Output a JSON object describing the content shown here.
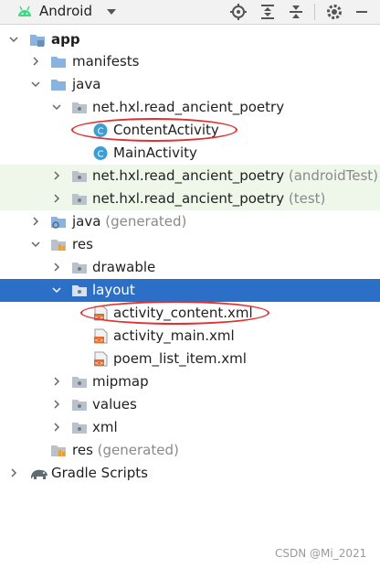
{
  "toolbar": {
    "title": "Android"
  },
  "tree": {
    "app": "app",
    "manifests": "manifests",
    "java": "java",
    "pkg_main": "net.hxl.read_ancient_poetry",
    "content_activity": "ContentActivity",
    "main_activity": "MainActivity",
    "pkg_android_test": "net.hxl.read_ancient_poetry",
    "android_test_suffix": "(androidTest)",
    "pkg_test": "net.hxl.read_ancient_poetry",
    "test_suffix": "(test)",
    "java_generated": "java",
    "generated_suffix": "(generated)",
    "res": "res",
    "drawable": "drawable",
    "layout": "layout",
    "activity_content": "activity_content.xml",
    "activity_main": "activity_main.xml",
    "poem_list_item": "poem_list_item.xml",
    "mipmap": "mipmap",
    "values": "values",
    "xml": "xml",
    "res_generated": "res",
    "res_generated_suffix": "(generated)",
    "gradle": "Gradle Scripts"
  },
  "watermark": "CSDN @Mi_2021",
  "colors": {
    "selection": "#2c6fc6",
    "highlight_circle": "#e13030",
    "source_set_background": "#eef7e9",
    "folder_blue": "#8ab4e0",
    "class_icon": "#3b9fd3"
  }
}
